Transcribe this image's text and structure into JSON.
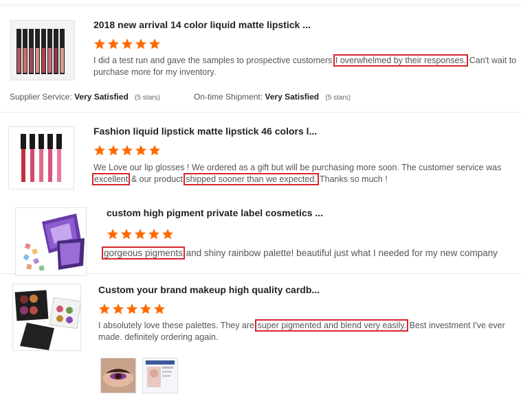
{
  "reviews": [
    {
      "title": "2018 new arrival 14 color liquid matte lipstick ...",
      "rating": 5,
      "text_before": "I did a test run and gave the samples to prospective customers ",
      "highlight_1": "I overwhelmed by their responses.",
      "text_mid": " Can't wait to purchase more for my inventory.",
      "supplier_label": "Supplier Service:",
      "supplier_value": "Very Satisfied",
      "supplier_stars": "(5 stars)",
      "shipment_label": "On-time Shipment:",
      "shipment_value": "Very Satisfied",
      "shipment_stars": "(5 stars)"
    },
    {
      "title": "Fashion liquid lipstick matte lipstick 46 colors l...",
      "rating": 5,
      "text_before": "We Love our lip glosses ! We ordered as a gift but will be purchasing more soon. The customer service was ",
      "highlight_1": "excellent",
      "text_mid": " & our product ",
      "highlight_2": "shipped sooner than we expected.",
      "text_after": " Thanks so much !"
    },
    {
      "title": "custom high pigment private label cosmetics ...",
      "rating": 5,
      "highlight_1": "gorgeous pigments",
      "text_mid": " and shiny rainbow palette! beautiful just what I needed for my new company"
    },
    {
      "title": "Custom your brand makeup high quality cardb...",
      "rating": 5,
      "text_before": "I absolutely love these palettes. They are ",
      "highlight_1": "super pigmented and blend very easily.",
      "text_mid": " Best investment I've ever made. definitely ordering again."
    }
  ],
  "colors": {
    "star": "#ff6a00",
    "highlight_border": "#d6262c",
    "divider": "#e6e6e6"
  }
}
